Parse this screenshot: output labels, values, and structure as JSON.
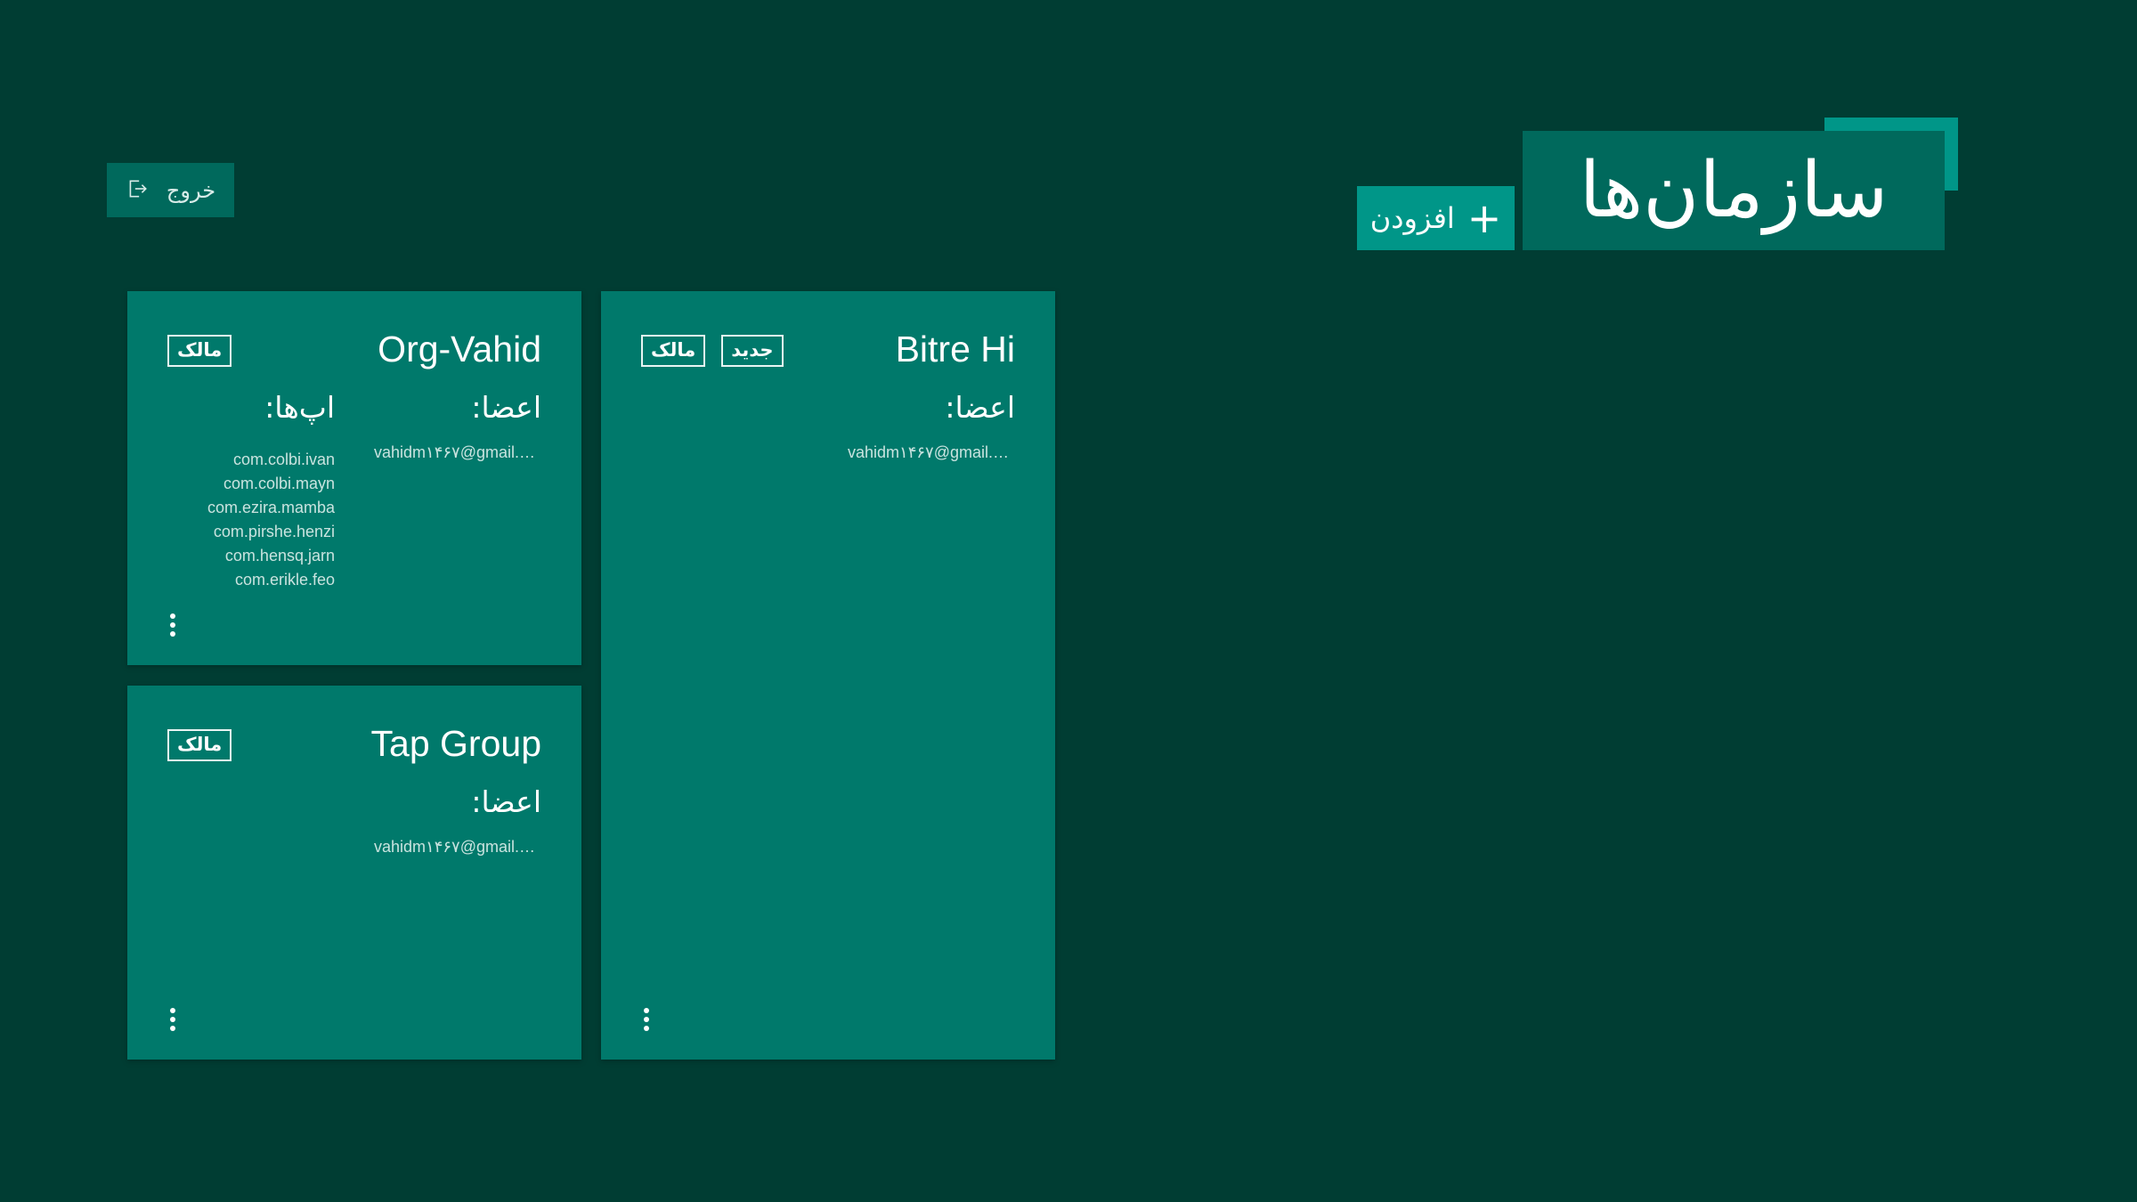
{
  "header": {
    "title": "سازمان‌ها",
    "add_label": "افزودن",
    "add_icon": "plus-icon",
    "logout_label": "خروج",
    "logout_icon": "logout-icon"
  },
  "colors": {
    "background": "#003d33",
    "card": "#00796b",
    "title_box": "#00695c",
    "accent": "#009688"
  },
  "labels": {
    "members": "اعضا:",
    "apps": "اپ‌ها:",
    "owner_badge": "مالک",
    "new_badge": "جدید"
  },
  "orgs": [
    {
      "name": "Org-Vahid",
      "badges": [
        "مالک"
      ],
      "members": [
        "vahidm۱۴۶۷@gmail.…"
      ],
      "apps": [
        "com.colbi.ivan",
        "com.colbi.mayn",
        "com.ezira.mamba",
        "com.pirshe.henzi",
        "com.hensq.jarn",
        "com.erikle.feo"
      ]
    },
    {
      "name": "Bitre Hi",
      "badges": [
        "مالک",
        "جدید"
      ],
      "members": [
        "vahidm۱۴۶۷@gmail.…"
      ],
      "apps": []
    },
    {
      "name": "Tap Group",
      "badges": [
        "مالک"
      ],
      "members": [
        "vahidm۱۴۶۷@gmail.…"
      ],
      "apps": []
    }
  ]
}
